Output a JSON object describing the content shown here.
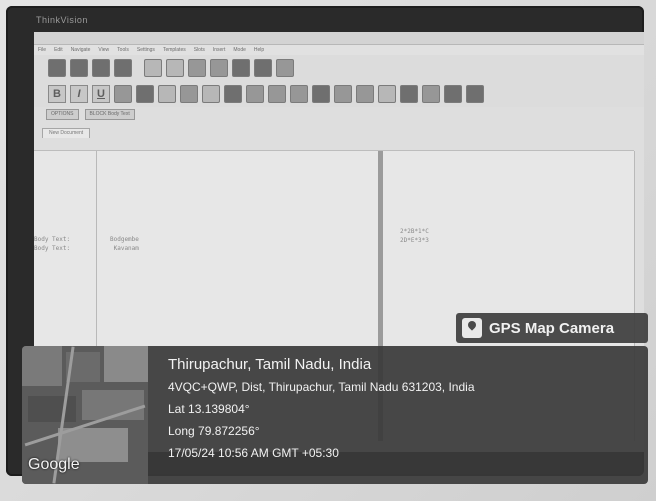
{
  "monitor": {
    "brand": "ThinkVision"
  },
  "app": {
    "menu": [
      "File",
      "Edit",
      "Navigate",
      "View",
      "Tools",
      "Settings",
      "Templates",
      "Slots",
      "Insert",
      "Mode",
      "Help"
    ],
    "buttons": [
      "OPTIONS",
      "BLOCK Body Text"
    ],
    "tab": "New Document",
    "left_text": "Body Text:\nBody Text:",
    "mid_text": "Bodgembe\n Kavanam",
    "right_text": "2*2B*1*C\n2D*E*3*3"
  },
  "gps": {
    "badge": "GPS Map Camera",
    "place": "Thirupachur, Tamil Nadu, India",
    "address": "4VQC+QWP, Dist, Thirupachur, Tamil Nadu 631203, India",
    "lat": "Lat 13.139804°",
    "long": "Long 79.872256°",
    "datetime": "17/05/24 10:56 AM GMT +05:30",
    "map_label": "Google"
  }
}
